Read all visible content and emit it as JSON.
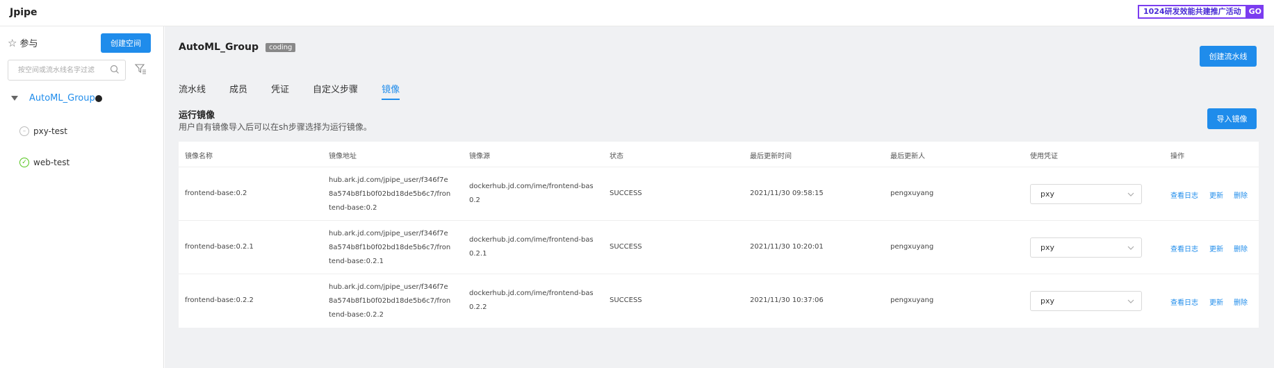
{
  "app": {
    "title": "Jpipe"
  },
  "promo": {
    "text": "1024研发效能共建推广活动",
    "go": "GO"
  },
  "sidebar": {
    "participate_label": "参与",
    "create_space_label": "创建空间",
    "search_placeholder": "按空间或流水线名字过滤",
    "group_name": "AutoML_Group",
    "pipelines": [
      {
        "name": "pxy-test",
        "status": "none"
      },
      {
        "name": "web-test",
        "status": "success"
      }
    ]
  },
  "main": {
    "group_name": "AutoML_Group",
    "group_tag": "coding",
    "create_pipeline_label": "创建流水线",
    "tabs": [
      {
        "label": "流水线",
        "active": false
      },
      {
        "label": "成员",
        "active": false
      },
      {
        "label": "凭证",
        "active": false
      },
      {
        "label": "自定义步骤",
        "active": false
      },
      {
        "label": "镜像",
        "active": true
      }
    ],
    "section_title": "运行镜像",
    "section_desc": "用户自有镜像导入后可以在sh步骤选择为运行镜像。",
    "import_label": "导入镜像"
  },
  "table": {
    "headers": [
      "镜像名称",
      "镜像地址",
      "镜像源",
      "状态",
      "最后更新时间",
      "最后更新人",
      "使用凭证",
      "操作"
    ],
    "rows": [
      {
        "name": "frontend-base:0.2",
        "address": "hub.ark.jd.com/jpipe_user/f346f7e8a574b8f1b0f02bd18de5b6c7/frontend-base:0.2",
        "source_line1": "dockerhub.jd.com/ime/frontend-base:",
        "source_line2": "0.2",
        "status": "SUCCESS",
        "updated_at": "2021/11/30 09:58:15",
        "updated_by": "pengxuyang",
        "credential": "pxy",
        "ops": [
          "查看日志",
          "更新",
          "删除"
        ]
      },
      {
        "name": "frontend-base:0.2.1",
        "address": "hub.ark.jd.com/jpipe_user/f346f7e8a574b8f1b0f02bd18de5b6c7/frontend-base:0.2.1",
        "source_line1": "dockerhub.jd.com/ime/frontend-base:",
        "source_line2": "0.2.1",
        "status": "SUCCESS",
        "updated_at": "2021/11/30 10:20:01",
        "updated_by": "pengxuyang",
        "credential": "pxy",
        "ops": [
          "查看日志",
          "更新",
          "删除"
        ]
      },
      {
        "name": "frontend-base:0.2.2",
        "address": "hub.ark.jd.com/jpipe_user/f346f7e8a574b8f1b0f02bd18de5b6c7/frontend-base:0.2.2",
        "source_line1": "dockerhub.jd.com/ime/frontend-base:",
        "source_line2": "0.2.2",
        "status": "SUCCESS",
        "updated_at": "2021/11/30 10:37:06",
        "updated_by": "pengxuyang",
        "credential": "pxy",
        "ops": [
          "查看日志",
          "更新",
          "删除"
        ]
      }
    ]
  }
}
